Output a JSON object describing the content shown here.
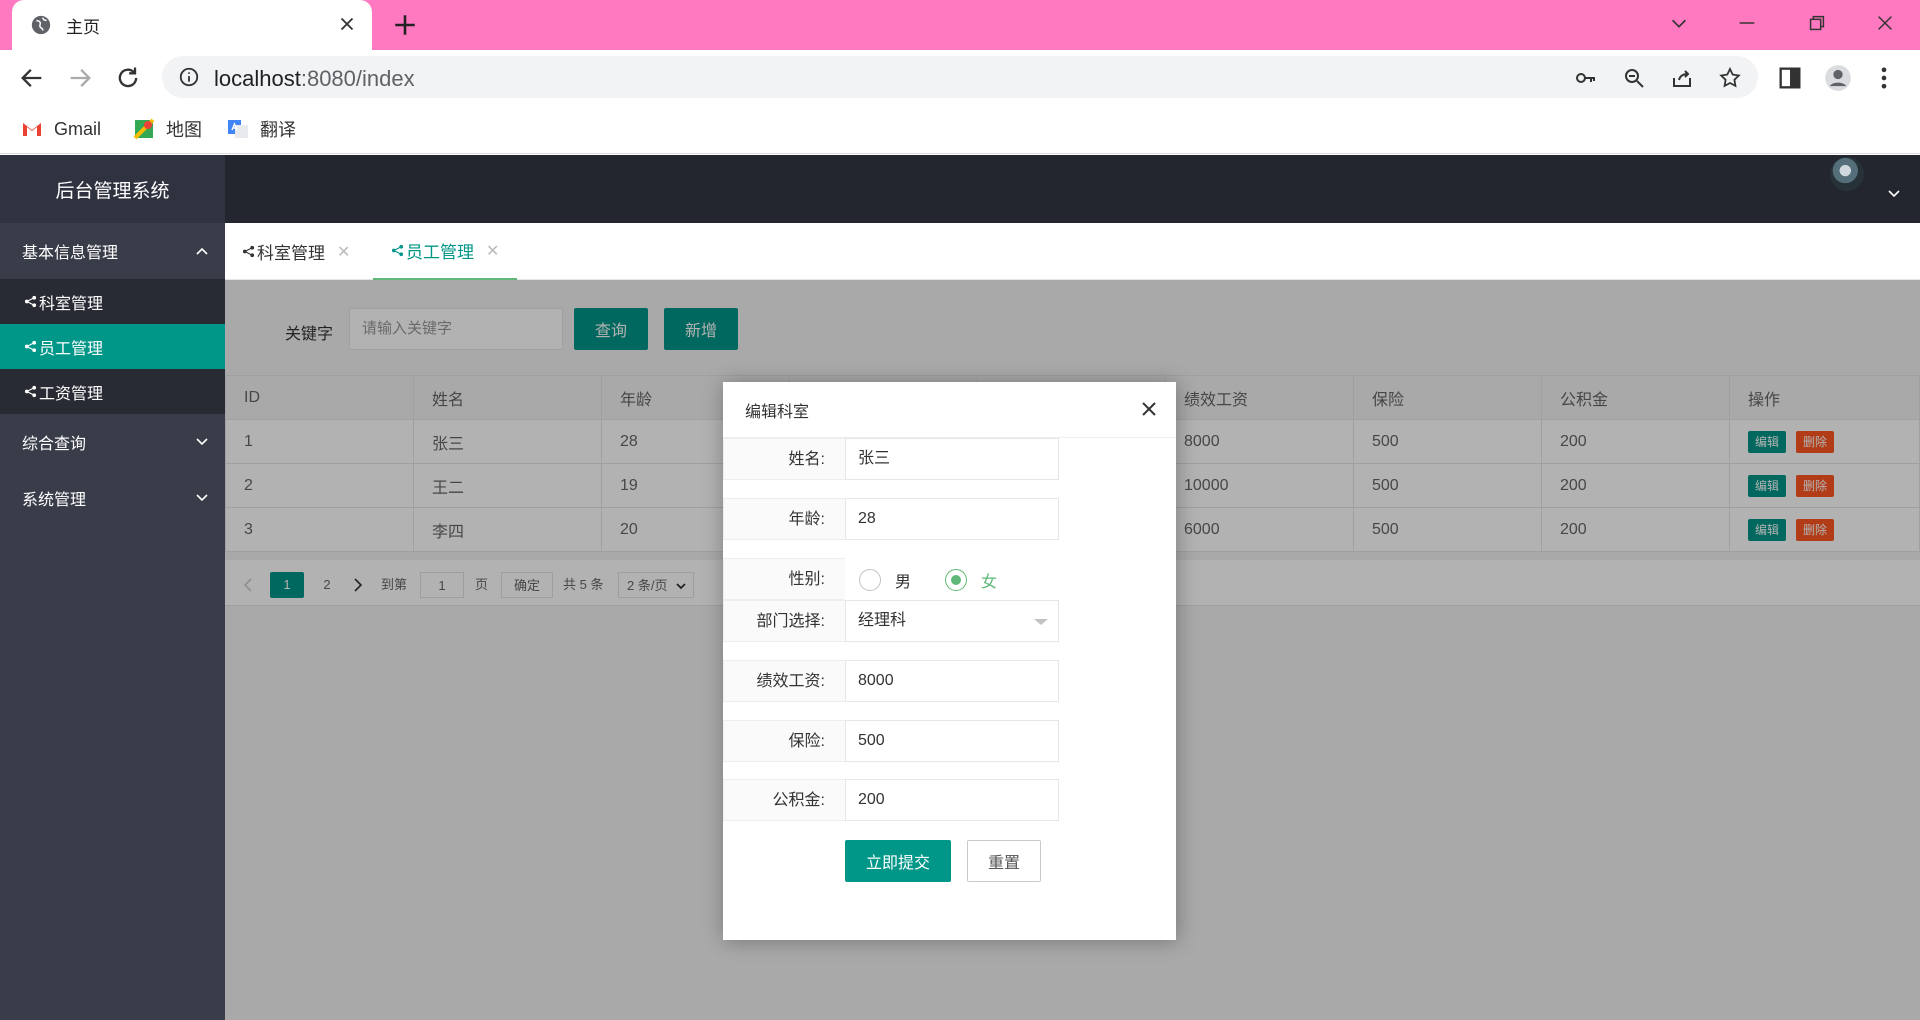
{
  "browser": {
    "tab_title": "主页",
    "url_host": "localhost",
    "url_rest": ":8080/index",
    "bookmarks": [
      "Gmail",
      "地图",
      "翻译"
    ]
  },
  "app": {
    "title": "后台管理系统",
    "menu": {
      "group1": "基本信息管理",
      "sub": [
        "科室管理",
        "员工管理",
        "工资管理"
      ],
      "group2": "综合查询",
      "group3": "系统管理"
    },
    "tabs": [
      "科室管理",
      "员工管理"
    ],
    "tab_close": "✕"
  },
  "search": {
    "label": "关键字",
    "placeholder": "请输入关键字",
    "query_btn": "查询",
    "add_btn": "新增"
  },
  "table": {
    "headers": [
      "ID",
      "姓名",
      "年龄",
      "",
      "",
      "绩效工资",
      "保险",
      "公积金",
      "操作"
    ],
    "rows": [
      [
        "1",
        "张三",
        "28",
        "",
        "",
        "8000",
        "500",
        "200"
      ],
      [
        "2",
        "王二",
        "19",
        "",
        "",
        "10000",
        "500",
        "200"
      ],
      [
        "3",
        "李四",
        "20",
        "",
        "",
        "6000",
        "500",
        "200"
      ]
    ],
    "edit_label": "编辑",
    "delete_label": "删除"
  },
  "pager": {
    "pages": [
      "1",
      "2"
    ],
    "goto_prefix": "到第",
    "goto_value": "1",
    "goto_suffix": "页",
    "confirm": "确定",
    "total": "共 5 条",
    "per_page": "2 条/页"
  },
  "modal": {
    "title": "编辑科室",
    "fields": {
      "name_label": "姓名:",
      "name_value": "张三",
      "age_label": "年龄:",
      "age_value": "28",
      "gender_label": "性别:",
      "gender_male": "男",
      "gender_female": "女",
      "dept_label": "部门选择:",
      "dept_value": "经理科",
      "perf_label": "绩效工资:",
      "perf_value": "8000",
      "ins_label": "保险:",
      "ins_value": "500",
      "fund_label": "公积金:",
      "fund_value": "200"
    },
    "selected_gender": "女",
    "submit": "立即提交",
    "reset": "重置"
  },
  "colors": {
    "primary": "#009688",
    "danger": "#ff5722",
    "sidebar": "#393d49",
    "header": "#23262e",
    "tabbar": "#ff79c0"
  }
}
